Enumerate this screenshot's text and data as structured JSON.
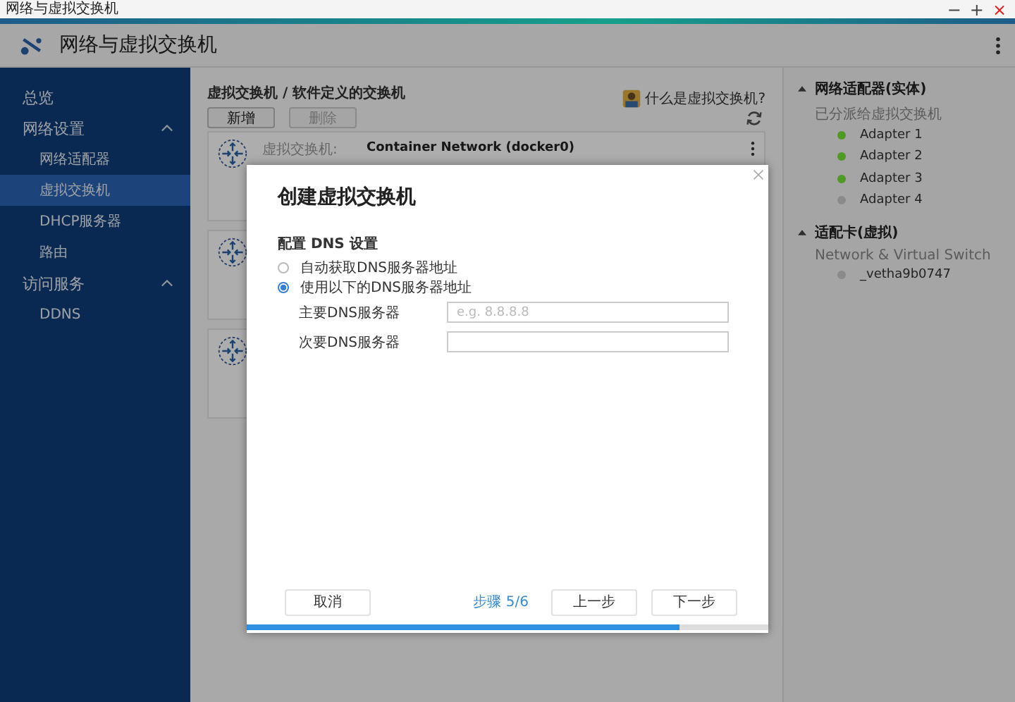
{
  "window": {
    "title": "网络与虚拟交换机",
    "controls": [
      "−",
      "+",
      "×"
    ]
  },
  "app_header": {
    "title": "网络与虚拟交换机"
  },
  "sidebar": {
    "items": [
      {
        "label": "总览",
        "selected": false
      },
      {
        "label": "网络设置",
        "selected": false,
        "expanded": true,
        "children": [
          {
            "label": "网络适配器",
            "selected": false
          },
          {
            "label": "虚拟交换机",
            "selected": true
          },
          {
            "label": "DHCP服务器",
            "selected": false
          },
          {
            "label": "路由",
            "selected": false
          }
        ]
      },
      {
        "label": "访问服务",
        "selected": false,
        "expanded": true,
        "children": [
          {
            "label": "DDNS",
            "selected": false
          }
        ]
      }
    ]
  },
  "main": {
    "breadcrumb": "虚拟交换机 / 软件定义的交换机",
    "help_link": "什么是虚拟交换机?",
    "buttons": [
      {
        "label": "新增",
        "disabled": false
      },
      {
        "label": "删除",
        "disabled": true
      }
    ],
    "switches": [
      {
        "kind": "full",
        "label": "虚拟交换机:",
        "name": "Container Network (docker0)"
      },
      {
        "kind": "covered"
      },
      {
        "kind": "covered"
      }
    ]
  },
  "right_panel": {
    "sections": [
      {
        "title": "网络适配器(实体)",
        "expanded": true,
        "subtitle": "已分派给虚拟交换机",
        "items": [
          {
            "name": "Adapter 1",
            "color": "#4f9a25"
          },
          {
            "name": "Adapter 2",
            "color": "#4f9a25"
          },
          {
            "name": "Adapter 3",
            "color": "#4f9a25"
          },
          {
            "name": "Adapter 4",
            "color": "#8a8a8a"
          }
        ]
      },
      {
        "title": "适配卡(虚拟)",
        "expanded": true,
        "subtitle": "Network & Virtual Switch",
        "items": [
          {
            "name": "_vetha9b0747",
            "color": "#8a8a8a"
          }
        ]
      }
    ]
  },
  "dialog": {
    "title": "创建虚拟交换机",
    "section": "配置 DNS 设置",
    "options": [
      {
        "label": "自动获取DNS服务器地址",
        "selected": false
      },
      {
        "label": "使用以下的DNS服务器地址",
        "selected": true
      }
    ],
    "fields": [
      {
        "label": "主要DNS服务器",
        "placeholder": "e.g. 8.8.8.8"
      },
      {
        "label": "次要DNS服务器"
      }
    ],
    "cancel": "取消",
    "step": "步骤 5/6",
    "back": "上一步",
    "next": "下一步",
    "progress": {
      "level": 0.83
    }
  }
}
